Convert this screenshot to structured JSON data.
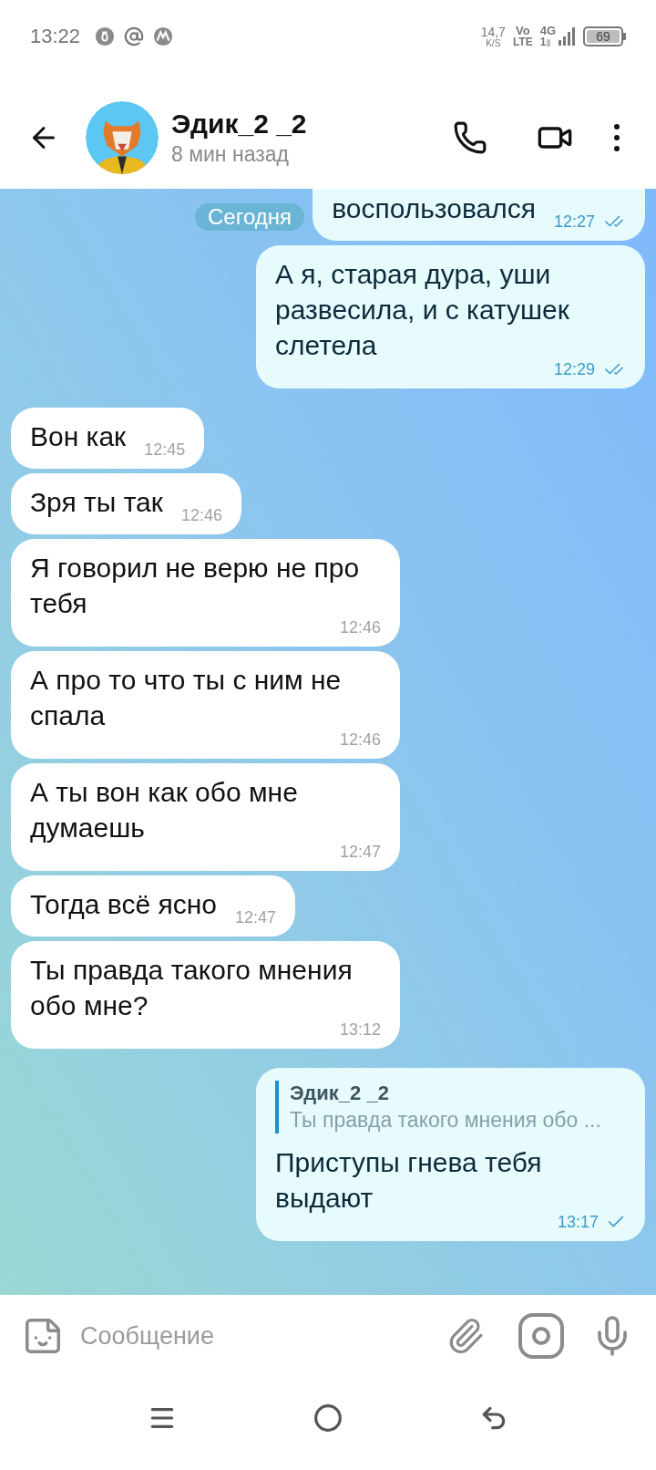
{
  "status_bar": {
    "time": "13:22",
    "speed": "14,7",
    "speed_unit": "K/S",
    "volte_top": "Vo",
    "volte_bottom": "LTE",
    "network": "4G",
    "sim": "1",
    "battery": "69"
  },
  "header": {
    "name": "Эдик_2 _2",
    "last_seen": "8 мин назад"
  },
  "date_pill": "Сегодня",
  "messages": [
    {
      "outgoing": true,
      "cut_top": true,
      "text": "воспользовался",
      "time": "12:27",
      "read": true
    },
    {
      "outgoing": true,
      "cut_top": false,
      "text": "А я, старая дура, уши развесила, и с катушек слетела",
      "time": "12:29",
      "read": true
    },
    {
      "outgoing": false,
      "cut_top": false,
      "text": "Вон как",
      "time": "12:45"
    },
    {
      "outgoing": false,
      "cut_top": false,
      "text": "Зря ты так",
      "time": "12:46"
    },
    {
      "outgoing": false,
      "cut_top": false,
      "text": "Я говорил не верю не про тебя",
      "time": "12:46"
    },
    {
      "outgoing": false,
      "cut_top": false,
      "text": "А про то что ты с ним не спала",
      "time": "12:46"
    },
    {
      "outgoing": false,
      "cut_top": false,
      "text": "А ты вон как обо мне думаешь",
      "time": "12:47"
    },
    {
      "outgoing": false,
      "cut_top": false,
      "text": "Тогда всё ясно",
      "time": "12:47"
    },
    {
      "outgoing": false,
      "cut_top": false,
      "text": "Ты правда такого мнения обо мне?",
      "time": "13:12"
    },
    {
      "outgoing": true,
      "cut_top": false,
      "reply": {
        "name": "Эдик_2 _2",
        "text": "Ты правда такого мнения обо ..."
      },
      "text": "Приступы гнева тебя выдают",
      "time": "13:17",
      "read": false
    }
  ],
  "composer": {
    "placeholder": "Сообщение"
  }
}
